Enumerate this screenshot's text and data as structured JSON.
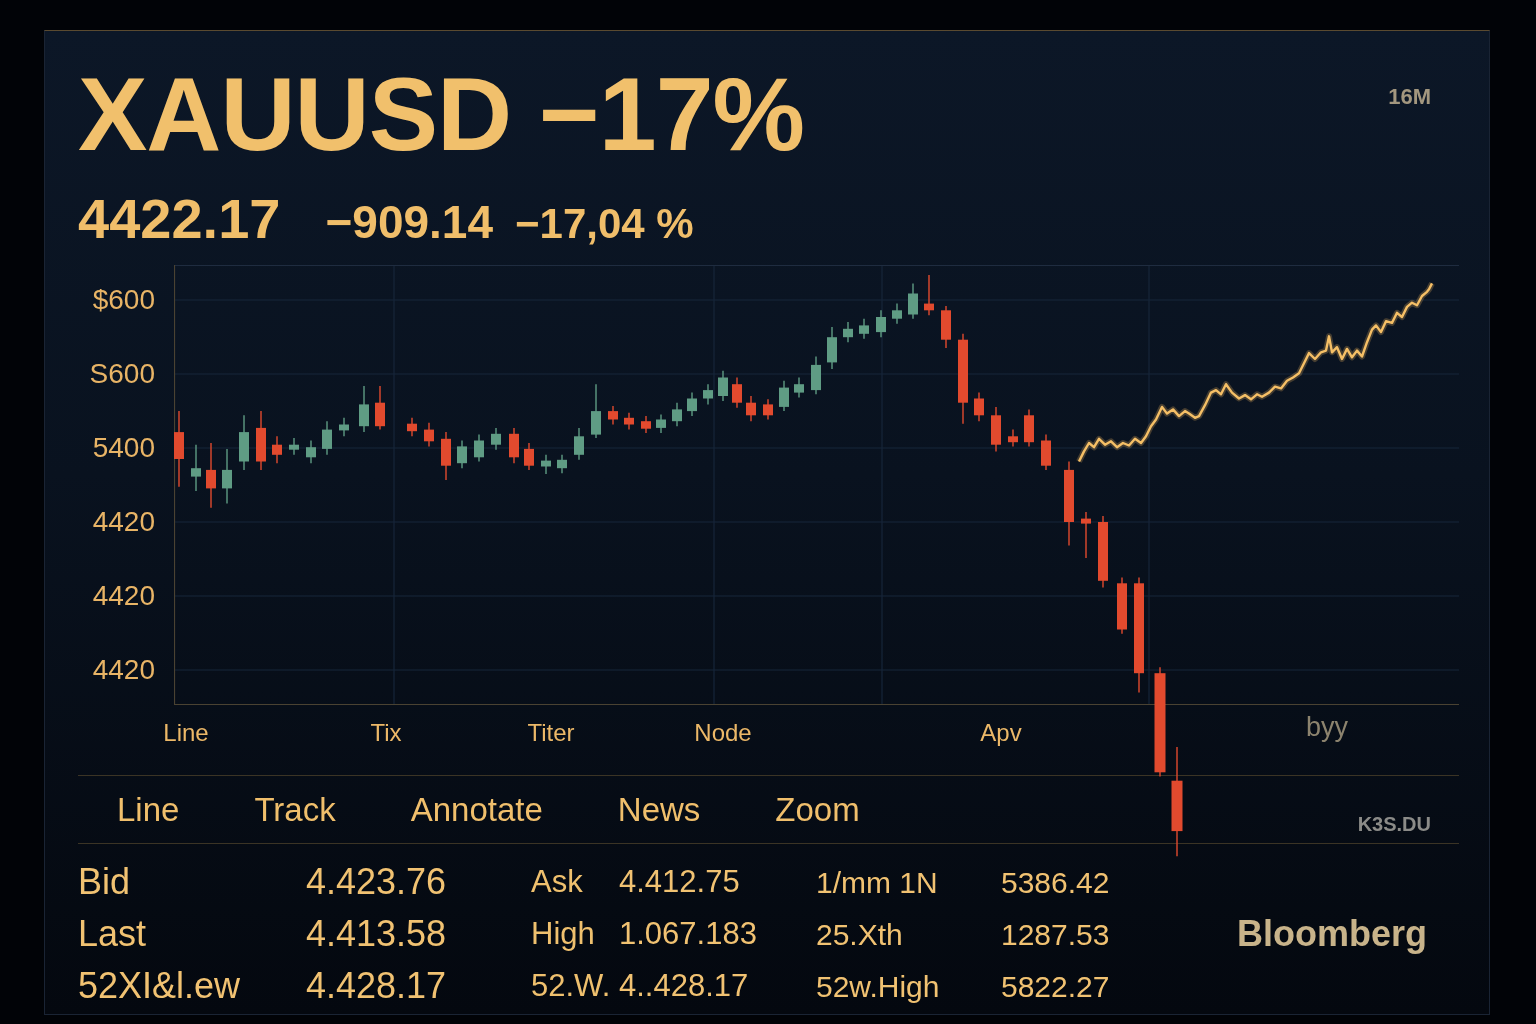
{
  "header": {
    "title": "XAUUSD −17%",
    "corner_label": "16M"
  },
  "quote": {
    "price": "4422.17",
    "change": "−909.14",
    "change_percent": "−17,04 %"
  },
  "chart": {
    "y_axis_labels": [
      "$600",
      "S600",
      "5400",
      "4420",
      "4420",
      "4420"
    ],
    "x_axis_labels": [
      "Line",
      "Tix",
      "Titer",
      "Node",
      "Apv"
    ],
    "corner_label": "byy"
  },
  "toolbar": {
    "buttons": [
      "Line",
      "Track",
      "Annotate",
      "News",
      "Zoom"
    ],
    "right_label": "K3S.DU"
  },
  "quote_table": {
    "rows": [
      {
        "cells": [
          {
            "label": "Bid",
            "value": "4.423.76"
          },
          {
            "label": "Ask",
            "value": "4.412.75"
          },
          {
            "label": "1/mm 1N",
            "value": "5386.42"
          }
        ]
      },
      {
        "cells": [
          {
            "label": "Last",
            "value": "4.413.58"
          },
          {
            "label": "High",
            "value": "1.067.183"
          },
          {
            "label": "25.Xth",
            "value": "1287.53"
          }
        ]
      },
      {
        "cells": [
          {
            "label": "52XI&l.ew",
            "value": "4.428.17"
          },
          {
            "label": "52.W.",
            "value": "4..428.17"
          },
          {
            "label": "52w.High",
            "value": "5822.27"
          }
        ]
      }
    ]
  },
  "brand": "Bloomberg"
}
